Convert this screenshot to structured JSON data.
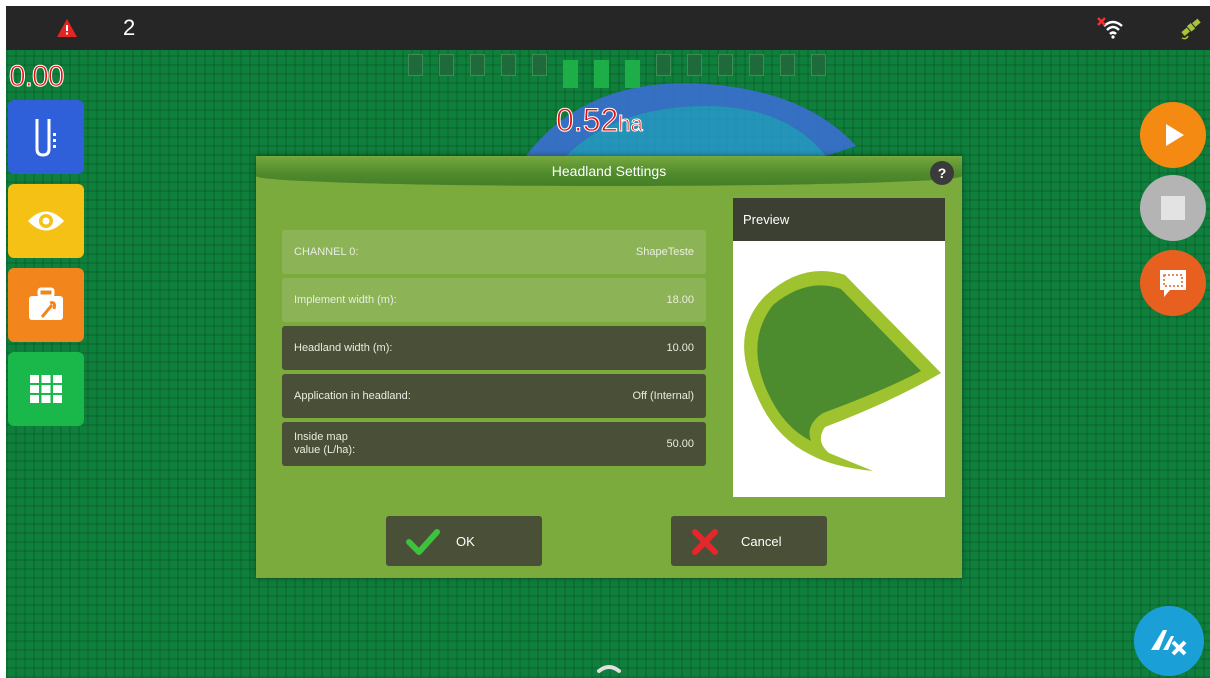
{
  "status_bar": {
    "alert_count": "2"
  },
  "work": {
    "speed": "0.00",
    "area_value": "0.52",
    "area_unit": "ha",
    "sections": [
      {
        "state": "off"
      },
      {
        "state": "off"
      },
      {
        "state": "off"
      },
      {
        "state": "off"
      },
      {
        "state": "off"
      },
      {
        "state": "on"
      },
      {
        "state": "on"
      },
      {
        "state": "on"
      },
      {
        "state": "off"
      },
      {
        "state": "off"
      },
      {
        "state": "off"
      },
      {
        "state": "off"
      },
      {
        "state": "off"
      },
      {
        "state": "off"
      }
    ]
  },
  "sidebar": {
    "items": [
      {
        "icon": "implement-icon",
        "color": "#2f5fd9"
      },
      {
        "icon": "eye-icon",
        "color": "#f4c114"
      },
      {
        "icon": "toolbox-icon",
        "color": "#f2851c"
      },
      {
        "icon": "grid-icon",
        "color": "#1ab84a"
      }
    ]
  },
  "right_controls": [
    {
      "icon": "play-icon",
      "color": "#f58a12"
    },
    {
      "icon": "stop-icon",
      "color": "#b4b4b4"
    },
    {
      "icon": "field-boundary-icon",
      "color": "#e86020"
    },
    {
      "icon": "brand-logo-icon",
      "color": "#1aa0d6"
    }
  ],
  "dialog": {
    "title": "Headland Settings",
    "help": "?",
    "rows": [
      {
        "label": "CHANNEL 0:",
        "value": "ShapeTeste"
      },
      {
        "label": "Implement width (m):",
        "value": "18.00"
      },
      {
        "label": "Headland width (m):",
        "value": "10.00"
      },
      {
        "label": "Application in headland:",
        "value": "Off (Internal)"
      },
      {
        "label": "Inside map\nvalue (L/ha):",
        "value": "50.00"
      }
    ],
    "preview_title": "Preview",
    "ok_label": "OK",
    "cancel_label": "Cancel"
  }
}
